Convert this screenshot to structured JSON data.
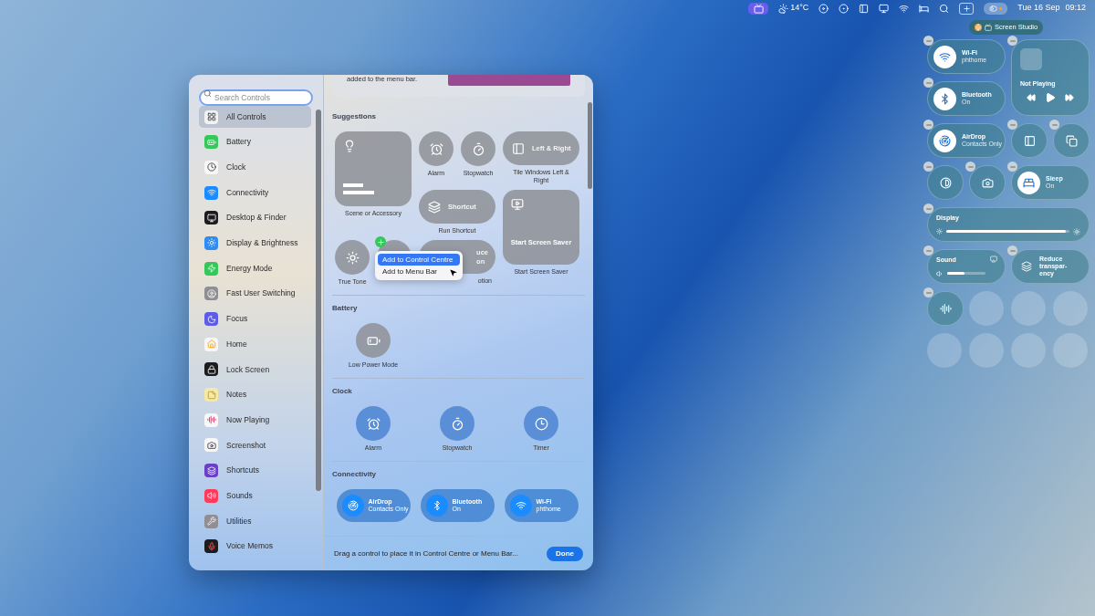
{
  "menu_bar": {
    "weather": "14°C",
    "date": "Tue 16 Sep",
    "time": "09:12",
    "control_centre_open": true
  },
  "recording_pill": {
    "label": "Screen Studio"
  },
  "gallery": {
    "search": {
      "placeholder": "Search Controls"
    },
    "sidebar": [
      {
        "label": "All Controls",
        "selected": true,
        "color": "#f2f2f4"
      },
      {
        "label": "Battery",
        "selected": false,
        "color": "#34c759"
      },
      {
        "label": "Clock",
        "selected": false,
        "color": "#f7f7f7"
      },
      {
        "label": "Connectivity",
        "selected": false,
        "color": "#1a8cff"
      },
      {
        "label": "Desktop & Finder",
        "selected": false,
        "color": "#1c1c1e"
      },
      {
        "label": "Display & Brightness",
        "selected": false,
        "color": "#2f8cf5"
      },
      {
        "label": "Energy Mode",
        "selected": false,
        "color": "#34c759"
      },
      {
        "label": "Fast User Switching",
        "selected": false,
        "color": "#8e8e93"
      },
      {
        "label": "Focus",
        "selected": false,
        "color": "#5e5ce6"
      },
      {
        "label": "Home",
        "selected": false,
        "color": "#f7f7f7"
      },
      {
        "label": "Lock Screen",
        "selected": false,
        "color": "#1c1c1e"
      },
      {
        "label": "Notes",
        "selected": false,
        "color": "#f5e9a8"
      },
      {
        "label": "Now Playing",
        "selected": false,
        "color": "#f7f7f7"
      },
      {
        "label": "Screenshot",
        "selected": false,
        "color": "#f7f7f7"
      },
      {
        "label": "Shortcuts",
        "selected": false,
        "color": "#6a3fc8"
      },
      {
        "label": "Sounds",
        "selected": false,
        "color": "#ff3b5c"
      },
      {
        "label": "Utilities",
        "selected": false,
        "color": "#8e8e93"
      },
      {
        "label": "Voice Memos",
        "selected": false,
        "color": "#1c1c1e"
      }
    ],
    "intro_text": "added to the menu bar.",
    "sections": [
      {
        "title": "Suggestions",
        "items": [
          {
            "kind": "large",
            "label": "Scene or Accessory"
          },
          {
            "kind": "circle",
            "label": "Alarm"
          },
          {
            "kind": "circle",
            "label": "Stopwatch"
          },
          {
            "kind": "wide",
            "text": "Left & Right",
            "label": "Tile Windows Left & Right"
          },
          {
            "kind": "wide",
            "text": "Shortcut",
            "label": "Run Shortcut"
          },
          {
            "kind": "circle",
            "label": "True Tone"
          },
          {
            "kind": "circle",
            "add_badge": true
          },
          {
            "kind": "wide",
            "text": "uce",
            "subtext": "on",
            "label": "otion"
          },
          {
            "kind": "large",
            "text": "Start Screen Saver",
            "label": "Start Screen Saver"
          }
        ]
      },
      {
        "title": "Battery",
        "items": [
          {
            "kind": "circle",
            "label": "Low Power Mode"
          }
        ]
      },
      {
        "title": "Clock",
        "items": [
          {
            "kind": "circle",
            "label": "Alarm"
          },
          {
            "kind": "circle",
            "label": "Stopwatch"
          },
          {
            "kind": "circle",
            "label": "Timer"
          }
        ]
      },
      {
        "title": "Connectivity",
        "items": [
          {
            "kind": "toggle",
            "text": "AirDrop",
            "subtext": "Contacts Only"
          },
          {
            "kind": "toggle",
            "text": "Bluetooth",
            "subtext": "On"
          },
          {
            "kind": "toggle",
            "text": "Wi-Fi",
            "subtext": "phthome"
          }
        ]
      }
    ],
    "context_menu": [
      {
        "label": "Add to Control Centre",
        "selected": true
      },
      {
        "label": "Add to Menu Bar",
        "selected": false
      }
    ],
    "hint": "Drag a control to place it in Control Centre or Menu Bar...",
    "done_button": "Done"
  },
  "control_centre": {
    "tiles": [
      {
        "kind": "toggle",
        "title": "Wi-Fi",
        "subtitle": "phthome"
      },
      {
        "kind": "media",
        "title": "Not Playing"
      },
      {
        "kind": "toggle",
        "title": "Bluetooth",
        "subtitle": "On"
      },
      {
        "kind": "toggle",
        "title": "AirDrop",
        "subtitle": "Contacts Only"
      },
      {
        "kind": "icon"
      },
      {
        "kind": "icon"
      },
      {
        "kind": "icon"
      },
      {
        "kind": "icon"
      },
      {
        "kind": "toggle",
        "title": "Sleep",
        "subtitle": "On"
      },
      {
        "kind": "slider",
        "title": "Display",
        "level": 0.97
      },
      {
        "kind": "sound",
        "title": "Sound",
        "level": 0.45
      },
      {
        "kind": "plain",
        "lines": [
          "Reduce",
          "transpar-",
          "ency"
        ]
      },
      {
        "kind": "icon"
      },
      {
        "kind": "empty"
      },
      {
        "kind": "empty"
      },
      {
        "kind": "empty"
      },
      {
        "kind": "empty"
      },
      {
        "kind": "empty"
      },
      {
        "kind": "empty"
      },
      {
        "kind": "empty"
      }
    ]
  }
}
